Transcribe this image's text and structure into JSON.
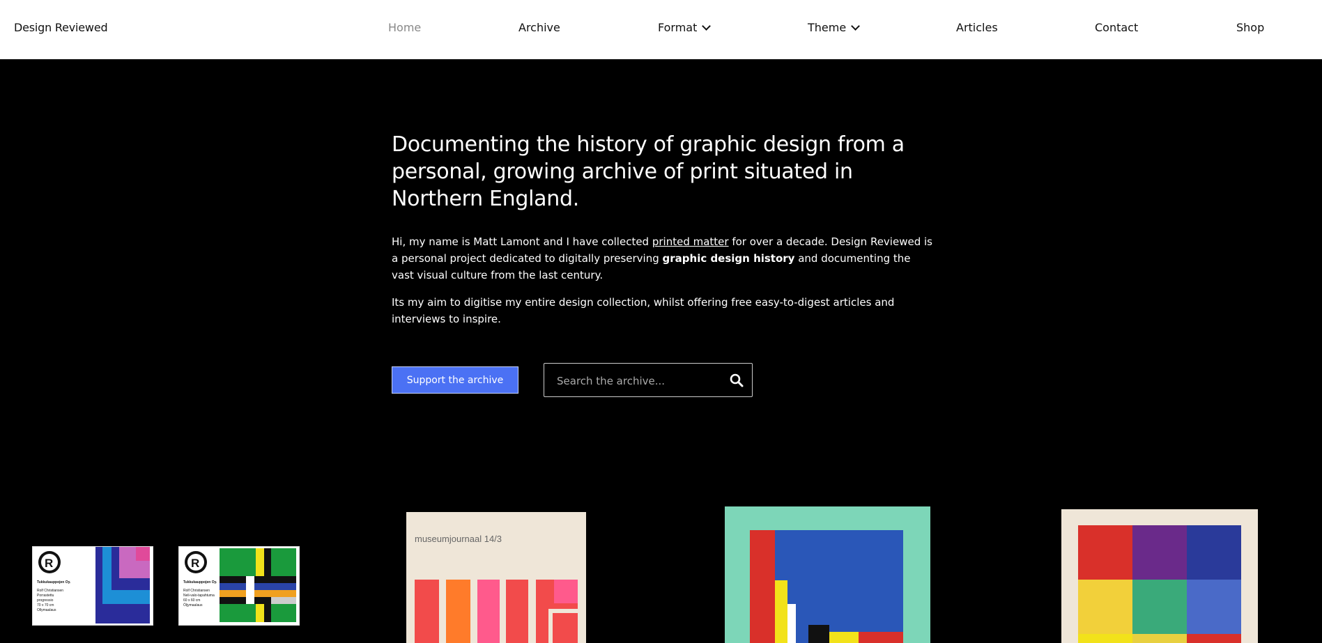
{
  "header": {
    "brand": "Design Reviewed",
    "nav": [
      {
        "label": "Home",
        "active": true,
        "dropdown": false
      },
      {
        "label": "Archive",
        "active": false,
        "dropdown": false
      },
      {
        "label": "Format",
        "active": false,
        "dropdown": true
      },
      {
        "label": "Theme",
        "active": false,
        "dropdown": true
      },
      {
        "label": "Articles",
        "active": false,
        "dropdown": false
      },
      {
        "label": "Contact",
        "active": false,
        "dropdown": false
      },
      {
        "label": "Shop",
        "active": false,
        "dropdown": false
      }
    ]
  },
  "hero": {
    "heading": "Documenting the history of graphic design from a personal, growing archive of print situated in Northern England.",
    "intro": {
      "part1": "Hi, my name is Matt Lamont and I have collected ",
      "link": "printed matter",
      "part2": " for over a decade. Design Reviewed is a personal project dedicated to digitally preserving ",
      "strong": "graphic design history",
      "part3": " and documenting the vast visual culture from the last century."
    },
    "aim": "Its my aim to digitise my entire design collection, whilst offering free easy-to-digest articles and interviews to inspire."
  },
  "actions": {
    "support_label": "Support the archive",
    "search_placeholder": "Search the archive..."
  },
  "gallery": {
    "card1": {
      "company": "Tukkukauppojen Oy.",
      "lines": [
        "Rolf Christiansen",
        "Porrastettu",
        "progressio",
        "70 x 70 cm",
        "Ollymaalaus"
      ]
    },
    "card2": {
      "company": "Tukkukauppojen Oy.",
      "lines": [
        "Rolf Christiansen",
        "Neli-valo-tapahtuma",
        "60 x 60 cm",
        "Öljymaalaus"
      ]
    },
    "magazine_title": "museumjournaal 14/3"
  },
  "colors": {
    "accent": "#4b71f4",
    "background": "#000000",
    "header_bg": "#ffffff"
  }
}
